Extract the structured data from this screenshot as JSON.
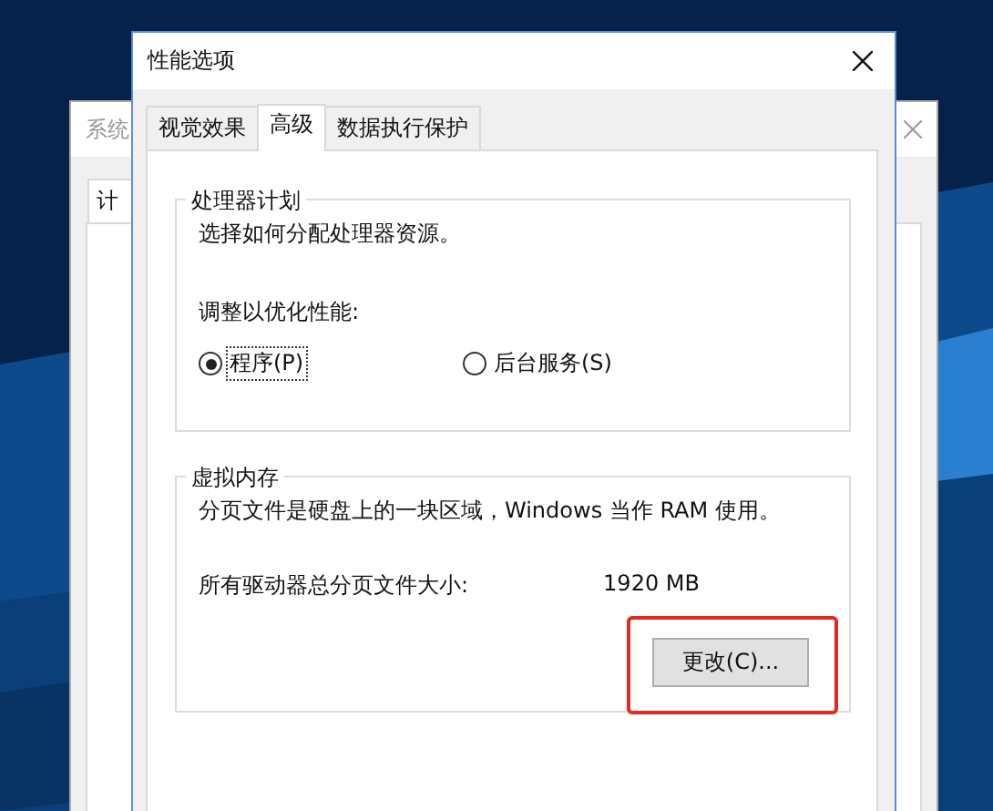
{
  "back_window": {
    "title": "系统",
    "tabs": [
      {
        "label": "计",
        "selected": true
      }
    ]
  },
  "window": {
    "title": "性能选项"
  },
  "tabs": [
    {
      "label": "视觉效果",
      "selected": false
    },
    {
      "label": "高级",
      "selected": true
    },
    {
      "label": "数据执行保护",
      "selected": false
    }
  ],
  "processor_group": {
    "title": "处理器计划",
    "description": "选择如何分配处理器资源。",
    "prompt": "调整以优化性能:",
    "options": [
      {
        "label": "程序(P)",
        "selected": true
      },
      {
        "label": "后台服务(S)",
        "selected": false
      }
    ]
  },
  "memory_group": {
    "title": "虚拟内存",
    "description": "分页文件是硬盘上的一块区域，Windows 当作 RAM 使用。",
    "size_label": "所有驱动器总分页文件大小:",
    "size_value": "1920 MB",
    "change_button": {
      "label": "更改(C)...",
      "highlighted": true
    }
  }
}
